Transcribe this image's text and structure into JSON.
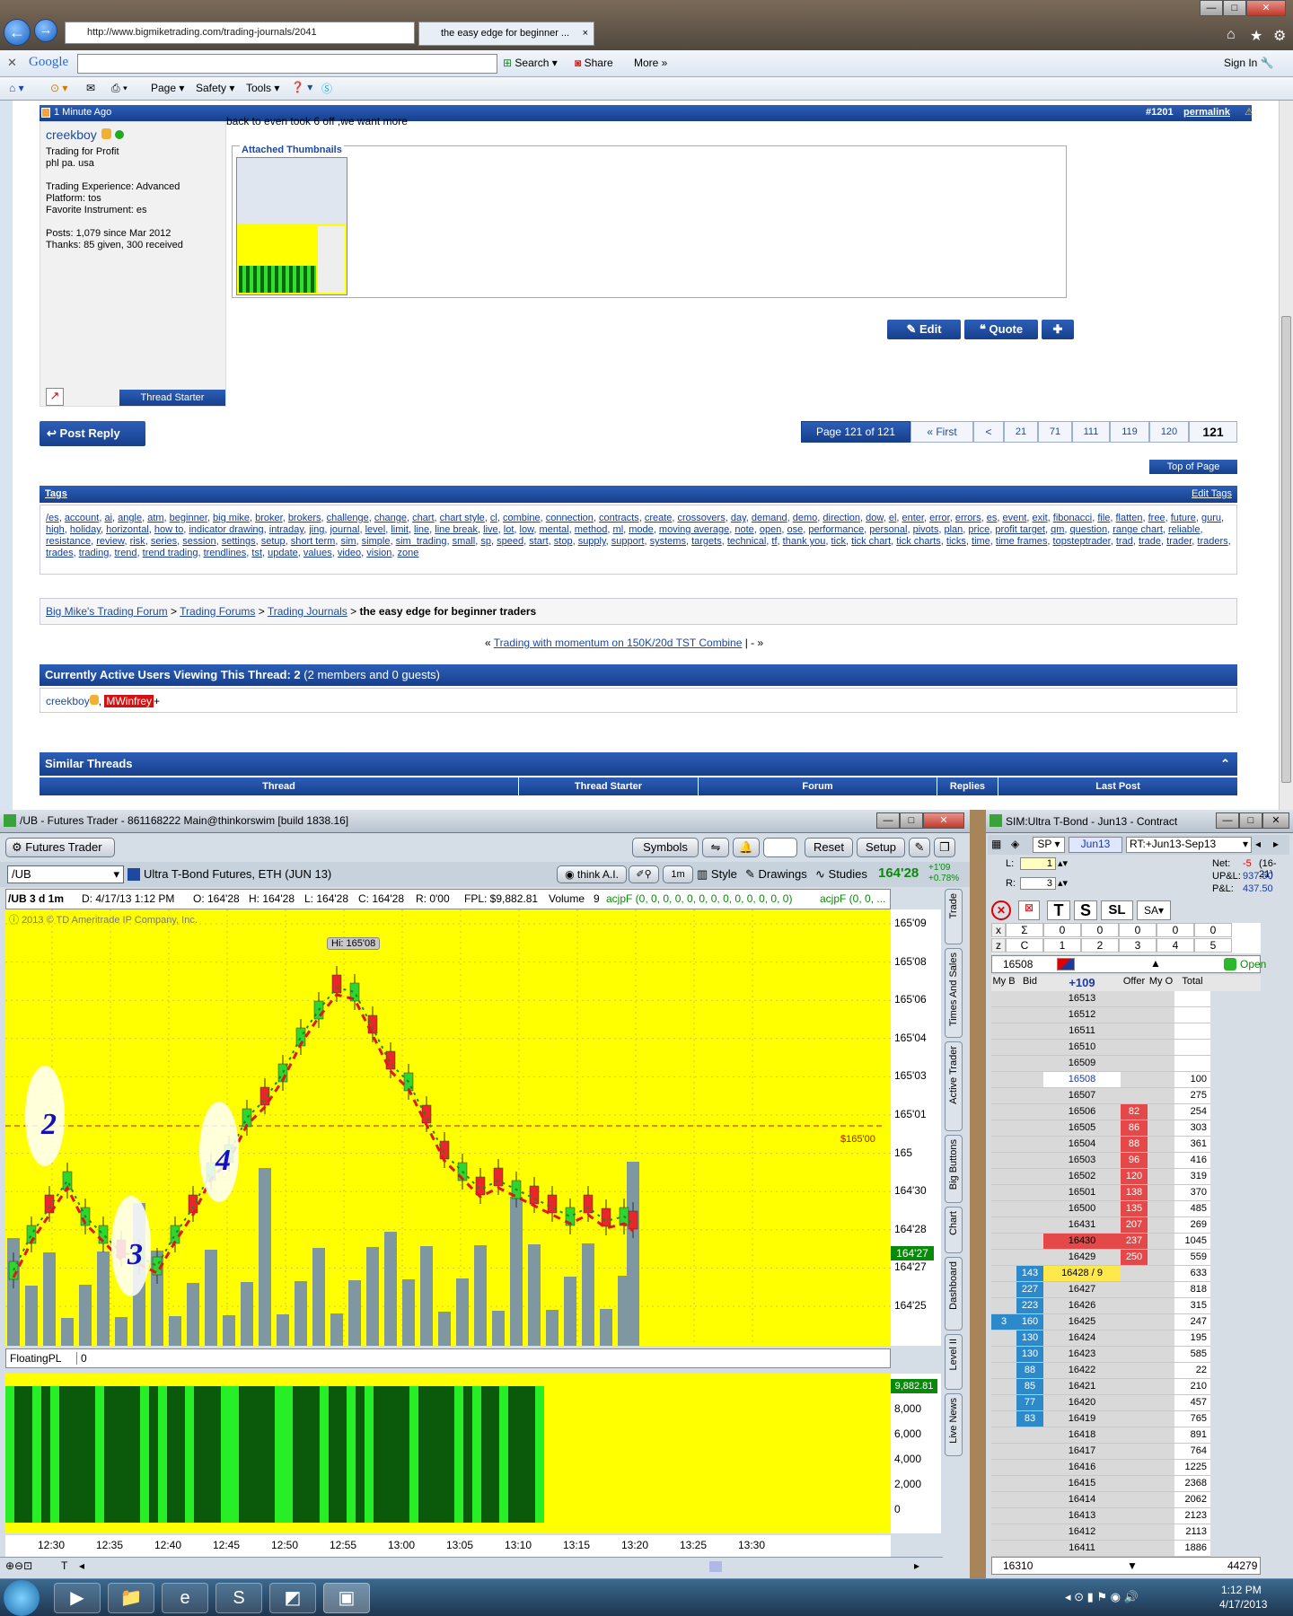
{
  "browser": {
    "url": "http://www.bigmiketrading.com/trading-journals/2041",
    "tab_title": "the easy edge for beginner ...",
    "google_label": "Google",
    "search_label": "Search",
    "share_label": "Share",
    "more_label": "More",
    "signin_label": "Sign In",
    "cmd_page": "Page",
    "cmd_safety": "Safety",
    "cmd_tools": "Tools"
  },
  "post": {
    "time": "1 Minute Ago",
    "post_number": "#1201",
    "permalink": "permalink",
    "username": "creekboy",
    "user_title": "Trading for Profit",
    "location": "phl pa. usa",
    "experience": "Trading Experience: Advanced",
    "platform": "Platform: tos",
    "instrument": "Favorite Instrument: es",
    "posts": "Posts: 1,079 since Mar 2012",
    "thanks": "Thanks: 85 given, 300 received",
    "body": "back to even took 6 off ,we want more",
    "attached_label": "Attached Thumbnails",
    "thread_starter": "Thread Starter",
    "edit": "Edit",
    "quote": "Quote"
  },
  "pagination": {
    "post_reply": "Post Reply",
    "page_label": "Page 121 of 121",
    "first": "« First",
    "prev": "<",
    "pages": [
      "21",
      "71",
      "111",
      "119",
      "120",
      "121"
    ],
    "top_of_page": "Top of Page"
  },
  "tags": {
    "title": "Tags",
    "edit": "Edit Tags",
    "list": [
      "/es",
      "account",
      "ai",
      "angle",
      "atm",
      "beginner",
      "big mike",
      "broker",
      "brokers",
      "challenge",
      "change",
      "chart",
      "chart style",
      "cl",
      "combine",
      "connection",
      "contracts",
      "create",
      "crossovers",
      "day",
      "demand",
      "demo",
      "direction",
      "dow",
      "el",
      "enter",
      "error",
      "errors",
      "es",
      "event",
      "exit",
      "fibonacci",
      "file",
      "flatten",
      "free",
      "future",
      "guru",
      "high",
      "holiday",
      "horizontal",
      "how to",
      "indicator drawing",
      "intraday",
      "jing",
      "journal",
      "level",
      "limit",
      "line",
      "line break",
      "live",
      "lot",
      "low",
      "mental",
      "method",
      "ml",
      "mode",
      "moving average",
      "note",
      "open",
      "ose",
      "performance",
      "personal",
      "pivots",
      "plan",
      "price",
      "profit target",
      "qm",
      "question",
      "range chart",
      "reliable",
      "resistance",
      "review",
      "risk",
      "series",
      "session",
      "settings",
      "setup",
      "short term",
      "sim",
      "simple",
      "sim_trading",
      "small",
      "sp",
      "speed",
      "start",
      "stop",
      "supply",
      "support",
      "systems",
      "targets",
      "technical",
      "tf",
      "thank you",
      "tick",
      "tick chart",
      "tick charts",
      "ticks",
      "time",
      "time frames",
      "topsteptrader",
      "trad",
      "trade",
      "trader",
      "traders",
      "trades",
      "trading",
      "trend",
      "trend trading",
      "trendlines",
      "tst",
      "update",
      "values",
      "video",
      "vision",
      "zone"
    ]
  },
  "breadcrumb": {
    "items": [
      "Big Mike's Trading Forum",
      "Trading Forums",
      "Trading Journals"
    ],
    "current": "the easy edge for beginner traders",
    "prev_thread": "Trading with momentum on 150K/20d TST Combine",
    "next_sep": "| - »"
  },
  "active_users": {
    "title": "Currently Active Users Viewing This Thread: 2",
    "detail": "(2 members and 0 guests)",
    "user1": "creekboy",
    "user2": "MWinfrey"
  },
  "similar": {
    "title": "Similar Threads",
    "columns": [
      "Thread",
      "Thread Starter",
      "Forum",
      "Replies",
      "Last Post"
    ]
  },
  "futures": {
    "title": "/UB - Futures Trader - 861168222 Main@thinkorswim [build 1838.16]",
    "tab": "Futures Trader",
    "symbols": "Symbols",
    "reset": "Reset",
    "setup": "Setup",
    "symbol": "/UB",
    "description": "Ultra T-Bond Futures, ETH (JUN 13)",
    "think_ai": "think A.I.",
    "interval": "1m",
    "style": "Style",
    "drawings": "Drawings",
    "studies": "Studies",
    "last_price": "164'28",
    "change": "+1'09",
    "change_pct": "+0.78%",
    "info": [
      "/UB 3 d 1m",
      "D: 4/17/13 1:12 PM",
      "O: 164'28",
      "H: 164'28",
      "L: 164'28",
      "C: 164'28",
      "R: 0'00",
      "FPL: $9,882.81",
      "Volume",
      "9"
    ],
    "study_label": "acjpF (0, 0, 0, 0, 0, 0, 0, 0, 0, 0, 0, 0, 0)",
    "study_label2": "acjpF (0, 0, ...",
    "copyright": "2013 © TD Ameritrade IP Company, Inc.",
    "hi_label": "Hi: 165'08",
    "price_line_label": "$165'00",
    "current_price_tag": "164'27",
    "sub_label": "FloatingPL",
    "sub_value": "0",
    "sub_current": "9,882.81",
    "vtabs": [
      "Trade",
      "Times And Sales",
      "Active Trader",
      "Big Buttons",
      "Chart",
      "Dashboard",
      "Level II",
      "Live News"
    ]
  },
  "chart_data": {
    "type": "candlestick",
    "price_ticks": [
      "165'09",
      "165'08",
      "165'06",
      "165'04",
      "165'03",
      "165'01",
      "165",
      "164'30",
      "164'28",
      "164'27",
      "164'25"
    ],
    "time_ticks": [
      "12:30",
      "12:35",
      "12:40",
      "12:45",
      "12:50",
      "12:55",
      "13:00",
      "13:05",
      "13:10",
      "13:15",
      "13:20",
      "13:25",
      "13:30"
    ],
    "sub_ticks": [
      "8,000",
      "6,000",
      "4,000",
      "2,000",
      "0"
    ],
    "wave_labels": [
      "2",
      "3",
      "4"
    ]
  },
  "ladder": {
    "title": "SIM:Ultra T-Bond - Jun13 - Contract",
    "symbol": "SP",
    "expiry": "Jun13",
    "spread": "RT:+Jun13-Sep13",
    "net_label": "Net:",
    "net": "-5",
    "net_range": "(16-21)",
    "upl_label": "UP&L:",
    "upl": "937.50",
    "pl_label": "P&L:",
    "pl": "437.50",
    "l_label": "L:",
    "l_val": "1",
    "r_label": "R:",
    "r_val": "3",
    "buttons": [
      "T",
      "S",
      "SL"
    ],
    "sigma_row": [
      "0",
      "0",
      "0",
      "0",
      "0"
    ],
    "c_row": [
      "1",
      "2",
      "3",
      "4",
      "5"
    ],
    "price_box": "16508",
    "status": "Open",
    "headers": [
      "My B",
      "Bid",
      "+109",
      "Offer",
      "My O",
      "Total"
    ],
    "rows": [
      [
        "",
        "",
        "16513",
        "",
        "",
        ""
      ],
      [
        "",
        "",
        "16512",
        "",
        "",
        ""
      ],
      [
        "",
        "",
        "16511",
        "",
        "",
        ""
      ],
      [
        "",
        "",
        "16510",
        "",
        "",
        ""
      ],
      [
        "",
        "",
        "16509",
        "",
        "",
        ""
      ],
      [
        "",
        "",
        "16508",
        "",
        "",
        "100"
      ],
      [
        "",
        "",
        "16507",
        "",
        "",
        "275"
      ],
      [
        "",
        "",
        "16506",
        "82",
        "",
        "254"
      ],
      [
        "",
        "",
        "16505",
        "86",
        "",
        "303"
      ],
      [
        "",
        "",
        "16504",
        "88",
        "",
        "361"
      ],
      [
        "",
        "",
        "16503",
        "96",
        "",
        "416"
      ],
      [
        "",
        "",
        "16502",
        "120",
        "",
        "319"
      ],
      [
        "",
        "",
        "16501",
        "138",
        "",
        "370"
      ],
      [
        "",
        "",
        "16500",
        "135",
        "",
        "485"
      ],
      [
        "",
        "",
        "16431",
        "207",
        "",
        "269"
      ],
      [
        "",
        "",
        "16430",
        "237",
        "",
        "1045"
      ],
      [
        "",
        "",
        "16429",
        "250",
        "",
        "559"
      ],
      [
        "",
        "143",
        "16428 / 9",
        "",
        "",
        "633"
      ],
      [
        "",
        "227",
        "16427",
        "",
        "",
        "818"
      ],
      [
        "",
        "223",
        "16426",
        "",
        "",
        "315"
      ],
      [
        "3",
        "160",
        "16425",
        "",
        "",
        "247"
      ],
      [
        "",
        "130",
        "16424",
        "",
        "",
        "195"
      ],
      [
        "",
        "130",
        "16423",
        "",
        "",
        "585"
      ],
      [
        "",
        "88",
        "16422",
        "",
        "",
        "22"
      ],
      [
        "",
        "85",
        "16421",
        "",
        "",
        "210"
      ],
      [
        "",
        "77",
        "16420",
        "",
        "",
        "457"
      ],
      [
        "",
        "83",
        "16419",
        "",
        "",
        "765"
      ],
      [
        "",
        "",
        "16418",
        "",
        "",
        "891"
      ],
      [
        "",
        "",
        "16417",
        "",
        "",
        "764"
      ],
      [
        "",
        "",
        "16416",
        "",
        "",
        "1225"
      ],
      [
        "",
        "",
        "16415",
        "",
        "",
        "2368"
      ],
      [
        "",
        "",
        "16414",
        "",
        "",
        "2062"
      ],
      [
        "",
        "",
        "16413",
        "",
        "",
        "2123"
      ],
      [
        "",
        "",
        "16412",
        "",
        "",
        "2113"
      ],
      [
        "",
        "",
        "16411",
        "",
        "",
        "1886"
      ]
    ],
    "footer_price": "16310",
    "footer_total": "44279"
  },
  "taskbar": {
    "time": "1:12 PM",
    "date": "4/17/2013"
  }
}
